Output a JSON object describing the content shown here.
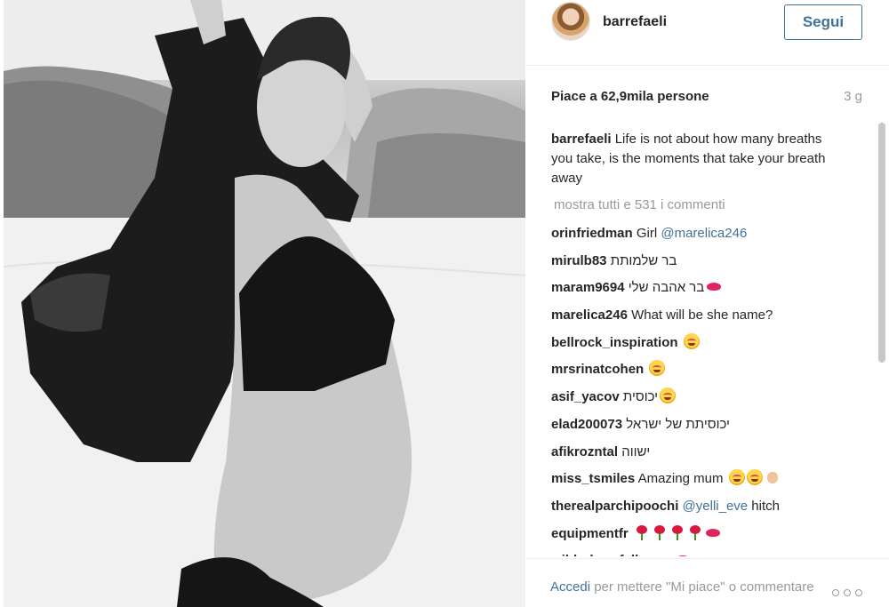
{
  "post": {
    "image_alt": "Black and white beach photo",
    "author": "barrefaeli",
    "follow_label": "Segui",
    "likes_text": "Piace a 62,9mila persone",
    "time_ago": "3 g",
    "caption_user": "barrefaeli",
    "caption_text": "Life is not about how many breaths you take, is the moments that take your breath away",
    "view_all_label": "mostra tutti e 531 i commenti"
  },
  "comments": [
    {
      "user": "orinfriedman",
      "text": "Girl ",
      "mention": "@marelica246",
      "emojis": []
    },
    {
      "user": "mirulb83",
      "text": "בר שלמותת",
      "mention": "",
      "emojis": []
    },
    {
      "user": "maram9694",
      "text": "בר אהבה שלי",
      "mention": "",
      "emojis": [
        "kiss-mark"
      ]
    },
    {
      "user": "marelica246",
      "text": "What will be she name?",
      "mention": "",
      "emojis": []
    },
    {
      "user": "bellrock_inspiration",
      "text": "",
      "mention": "",
      "emojis": [
        "heart-eyes-face"
      ]
    },
    {
      "user": "mrsrinatcohen",
      "text": "",
      "mention": "",
      "emojis": [
        "heart-eyes-face"
      ]
    },
    {
      "user": "asif_yacov",
      "text": "יכוסית",
      "mention": "",
      "emojis": [
        "kissing-face"
      ]
    },
    {
      "user": "elad200073",
      "text": "יכוסיתת של ישראל",
      "mention": "",
      "emojis": []
    },
    {
      "user": "afikrozntal",
      "text": "ישווה",
      "mention": "",
      "emojis": []
    },
    {
      "user": "miss_tsmiles",
      "text": "Amazing mum ",
      "mention": "",
      "emojis": [
        "kissing-face",
        "heart-eyes-face",
        "ok-hand"
      ]
    },
    {
      "user": "therealparchipoochi",
      "text": "",
      "mention": "@yelli_eve",
      "text_after": " hitch",
      "emojis": []
    },
    {
      "user": "equipmentfr",
      "text": "",
      "mention": "",
      "emojis": [
        "rose",
        "rose",
        "rose",
        "rose",
        "kiss-mark"
      ]
    },
    {
      "user": "wilderbuzzfeller",
      "text": "",
      "mention": "",
      "emojis": [
        "sweet",
        "kiss-mark"
      ]
    }
  ],
  "footer": {
    "login_link": "Accedi",
    "login_rest": " per mettere \"Mi piace\" o commentare",
    "more_icon": "more-options-icon"
  },
  "colors": {
    "link_blue": "#3f729b",
    "muted": "#999999",
    "text": "#262626"
  }
}
